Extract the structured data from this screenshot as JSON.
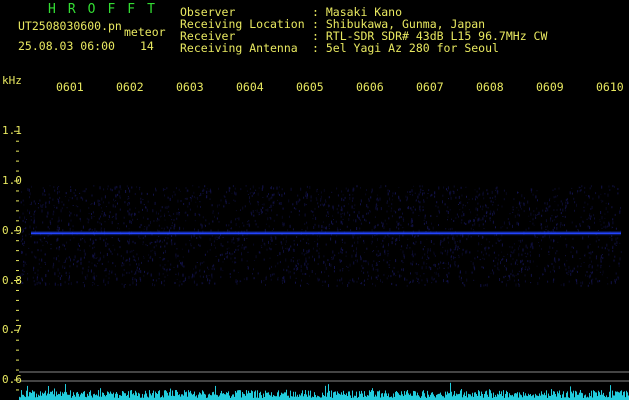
{
  "header": {
    "program": "HROFFT",
    "filename": "UT2508030600.pn",
    "datetime": "25.08.03 06:00",
    "mode": "meteor",
    "count": "14",
    "fields": [
      {
        "label": "Observer",
        "value": ": Masaki Kano"
      },
      {
        "label": "Receiving Location",
        "value": ": Shibukawa, Gunma, Japan"
      },
      {
        "label": "Receiver",
        "value": ": RTL-SDR SDR# 43dB L15 96.7MHz CW"
      },
      {
        "label": "Receiving Antenna",
        "value": ": 5el Yagi Az 280 for Seoul"
      }
    ]
  },
  "spectrogram": {
    "y_unit": "kHz",
    "y_ticks": [
      "1.1",
      "1.0",
      "0.9",
      "0.8",
      "0.7",
      "0.6"
    ],
    "x_ticks": [
      "0601",
      "0602",
      "0603",
      "0604",
      "0605",
      "0606",
      "0607",
      "0608",
      "0609",
      "0610"
    ],
    "signal_khz": 0.895,
    "colors": {
      "text": "#e8e860",
      "title": "#33dd33",
      "trace": "#2244ff",
      "noise": "#1a1a6a",
      "power": "#22ccdd"
    }
  }
}
